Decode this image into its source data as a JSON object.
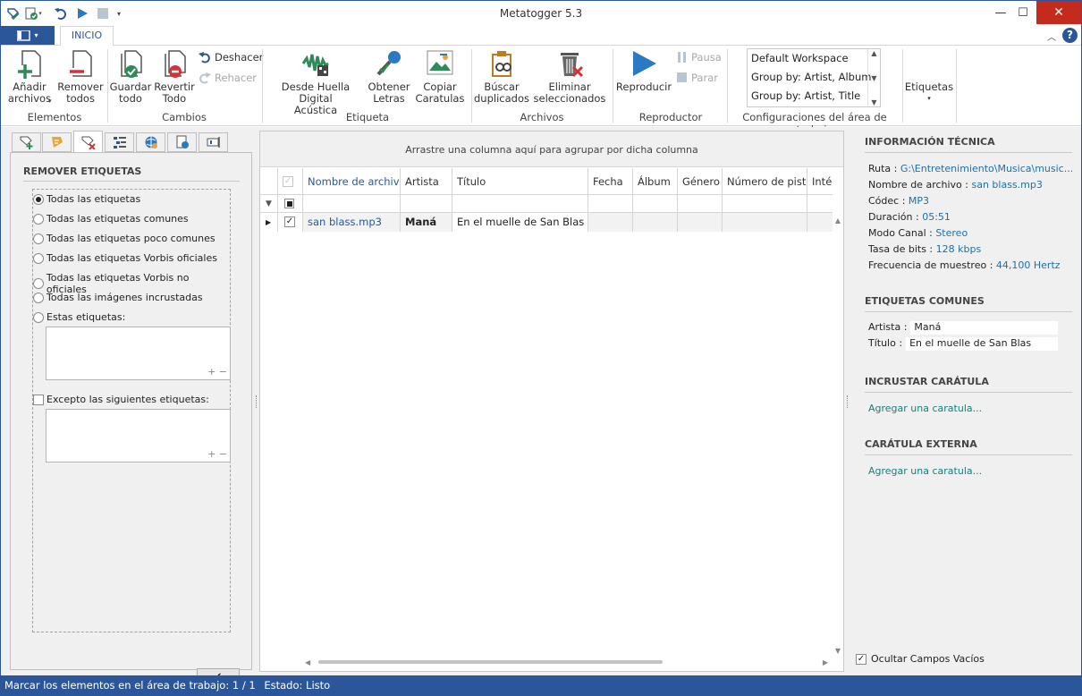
{
  "window": {
    "title": "Metatogger 5.3"
  },
  "tabs": {
    "inicio": "INICIO"
  },
  "ribbon": {
    "add_files": "Añadir\narchivos",
    "remove_all": "Remover\ntodos",
    "save_all": "Guardar\ntodo",
    "revert_all": "Revertir\nTodo",
    "undo": "Deshacer",
    "redo": "Rehacer",
    "fingerprint": "Desde Huella Digital\nAcústica",
    "lyrics": "Obtener\nLetras",
    "covers": "Copiar\nCaratulas",
    "duplicates": "Búscar\nduplicados",
    "delete_selected": "Eliminar\nseleccionados",
    "play": "Reproducir",
    "pause": "Pausa",
    "stop": "Parar",
    "tags": "Etiquetas",
    "groups": {
      "elements": "Elementos",
      "changes": "Cambios",
      "tag": "Etiqueta",
      "files": "Archivos",
      "player": "Reproductor",
      "workspace": "Configuraciones del área de trabajo"
    },
    "workspaces": [
      "Default Workspace",
      "Group by: Artist, Album",
      "Group by: Artist, Title"
    ]
  },
  "left": {
    "title": "REMOVER ETIQUETAS",
    "options": [
      "Todas las etiquetas",
      "Todas las etiquetas comunes",
      "Todas las etiquetas poco comunes",
      "Todas las etiquetas Vorbis oficiales",
      "Todas las etiquetas Vorbis no oficiales",
      "Todas las imágenes incrustadas",
      "Estas etiquetas:"
    ],
    "selected_option": "Todas las etiquetas",
    "except_label": "Excepto las siguientes etiquetas:"
  },
  "grid": {
    "group_hint": "Arrastre una columna aquí para agrupar por dicha columna",
    "columns": [
      "Nombre de archivo",
      "Artista",
      "Título",
      "Fecha",
      "Álbum",
      "Género",
      "Número de pista",
      "Intérprete"
    ],
    "rows": [
      {
        "filename": "san blass.mp3",
        "artist": "Maná",
        "title": "En el muelle de San Blas",
        "checked": true
      }
    ]
  },
  "right": {
    "tech_title": "INFORMACIÓN TÉCNICA",
    "tech": [
      {
        "label": "Ruta : ",
        "value": "G:\\Entretenimiento\\Musica\\music..."
      },
      {
        "label": "Nombre de archivo : ",
        "value": "san blass.mp3"
      },
      {
        "label": "Códec : ",
        "value": "MP3"
      },
      {
        "label": "Duración : ",
        "value": "05:51"
      },
      {
        "label": "Modo Canal : ",
        "value": "Stereo"
      },
      {
        "label": "Tasa de bits : ",
        "value": "128 kbps"
      },
      {
        "label": "Frecuencia de muestreo : ",
        "value": "44,100 Hertz"
      }
    ],
    "common_title": "ETIQUETAS COMUNES",
    "common": [
      {
        "label": "Artista :",
        "value": "Maná"
      },
      {
        "label": "Título :",
        "value": "En el muelle de San Blas"
      }
    ],
    "embed_title": "INCRUSTAR CARÁTULA",
    "embed_link": "Agregar una caratula...",
    "external_title": "CARÁTULA EXTERNA",
    "external_link": "Agregar una caratula...",
    "hide_empty": "Ocultar Campos Vacíos"
  },
  "status": {
    "label": "Marcar los elementos en el área de trabajo:",
    "count": "1 / 1",
    "state_label": "Estado:",
    "state": "Listo"
  }
}
